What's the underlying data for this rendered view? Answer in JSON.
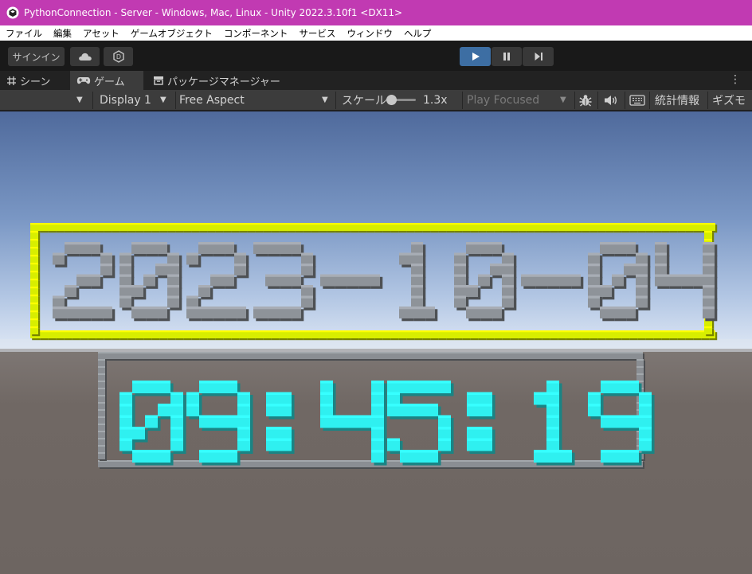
{
  "window": {
    "title": "PythonConnection - Server - Windows, Mac, Linux - Unity 2022.3.10f1 <DX11>",
    "title_color": "#c13ab2"
  },
  "menu": [
    "ファイル",
    "編集",
    "アセット",
    "ゲームオブジェクト",
    "コンポーネント",
    "サービス",
    "ウィンドウ",
    "ヘルプ"
  ],
  "toolbar": {
    "signin_label": "サインイン",
    "cloud_icon": "cloud-icon",
    "collab_icon": "collab-icon",
    "play_icon": "play-icon",
    "pause_icon": "pause-icon",
    "step_icon": "step-icon",
    "play_active_color": "#3d6ea3"
  },
  "tabs": [
    {
      "label": "シーン",
      "icon": "grid-icon",
      "selected": false
    },
    {
      "label": "ゲーム",
      "icon": "gamepad-icon",
      "selected": true
    },
    {
      "label": "パッケージマネージャー",
      "icon": "package-icon",
      "selected": false
    }
  ],
  "game_toolbar": {
    "display": "Display 1",
    "aspect": "Free Aspect",
    "scale_label": "スケール",
    "scale_value": "1.3x",
    "scale_fraction": 0.05,
    "play_mode": "Play Focused",
    "stats_label": "統計情報",
    "gizmos_label": "ギズモ"
  },
  "scene": {
    "date_text": "2023-10-04",
    "time_text": "09:45:19",
    "date_frame_color": "#d8ee00",
    "date_digit_color": "#8e9399",
    "time_frame_color": "#8a8e93",
    "time_digit_color": "#2ff0f0",
    "sky_top": "#4f6a9c",
    "horizon": "#d9e4f4",
    "ground": "#6e6662"
  }
}
